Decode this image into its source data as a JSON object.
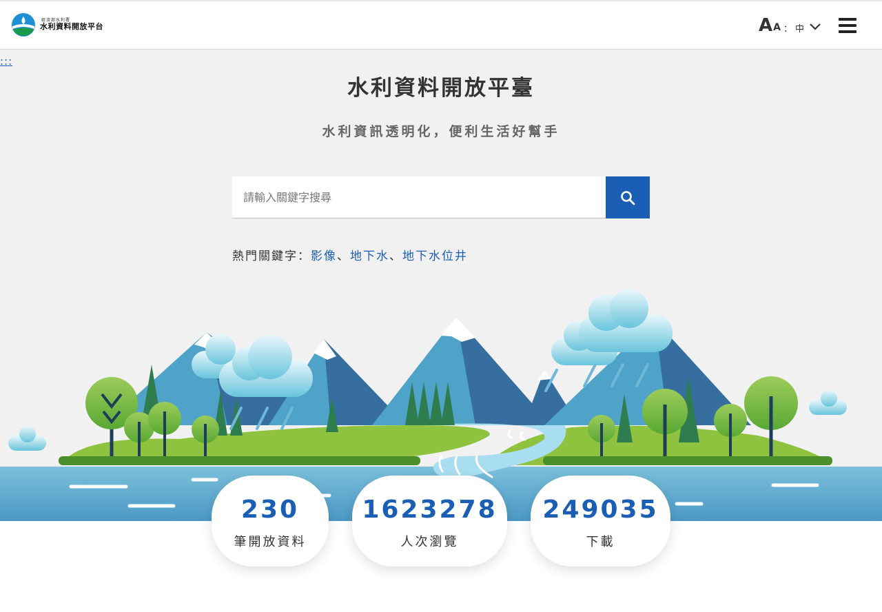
{
  "header": {
    "logo_small_text": "經濟部水利署",
    "logo_text": "水利資料開放平台",
    "font_size_big": "A",
    "font_size_small": "A",
    "separator": "：",
    "language_current": "中"
  },
  "accesskey": ":::",
  "hero": {
    "title": "水利資料開放平臺",
    "subtitle": "水利資訊透明化，便利生活好幫手"
  },
  "search": {
    "placeholder": "請輸入關鍵字搜尋"
  },
  "hot_keywords": {
    "label": "熱門關鍵字：",
    "items": [
      "影像",
      "地下水",
      "地下水位井"
    ],
    "separator": "、"
  },
  "stats": [
    {
      "value": "230",
      "label": "筆開放資料"
    },
    {
      "value": "1623278",
      "label": "人次瀏覽"
    },
    {
      "value": "249035",
      "label": "下載"
    }
  ],
  "colors": {
    "accent": "#1a5fb4",
    "background": "#f1f1f1",
    "river": "#6fb3d5"
  }
}
